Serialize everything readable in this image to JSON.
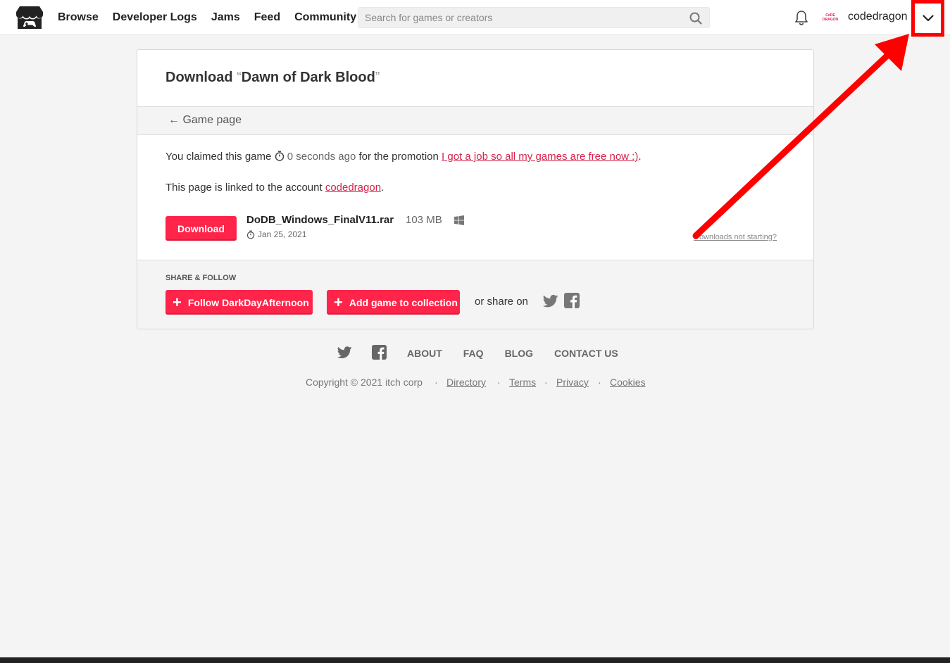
{
  "header": {
    "nav": [
      "Browse",
      "Developer Logs",
      "Jams",
      "Feed",
      "Community"
    ],
    "search_placeholder": "Search for games or creators",
    "avatar_text": "CoDE DRAGON",
    "username": "codedragon"
  },
  "card": {
    "title_prefix": "Download ",
    "open_quote": "“",
    "game_title": "Dawn of Dark Blood",
    "close_quote": "”",
    "back_link": "← Game page",
    "claim_text": "You claimed this game",
    "claim_time": "0 seconds ago",
    "claim_for": "for the promotion",
    "promotion_link": "I got a job so all my games are free now :)",
    "claim_end": ".",
    "linked_text": "This page is linked to the account",
    "linked_account": "codedragon",
    "linked_end": ".",
    "download_label": "Download",
    "file_name": "DoDB_Windows_FinalV11.rar",
    "file_size": "103 MB",
    "file_date": "Jan 25, 2021",
    "not_starting": "Downloads not starting?",
    "share_label": "SHARE & FOLLOW",
    "follow_label": "Follow DarkDayAfternoon",
    "collection_label": "Add game to collection",
    "share_on": "or share on"
  },
  "footer": {
    "links": [
      "ABOUT",
      "FAQ",
      "BLOG",
      "CONTACT US"
    ],
    "copyright": "Copyright © 2021 itch corp",
    "sep": "·",
    "legal_links": [
      "Directory",
      "Terms",
      "Privacy",
      "Cookies"
    ]
  },
  "colors": {
    "accent": "#ff2449",
    "link": "#d5234a",
    "annotation": "#ff0000"
  }
}
